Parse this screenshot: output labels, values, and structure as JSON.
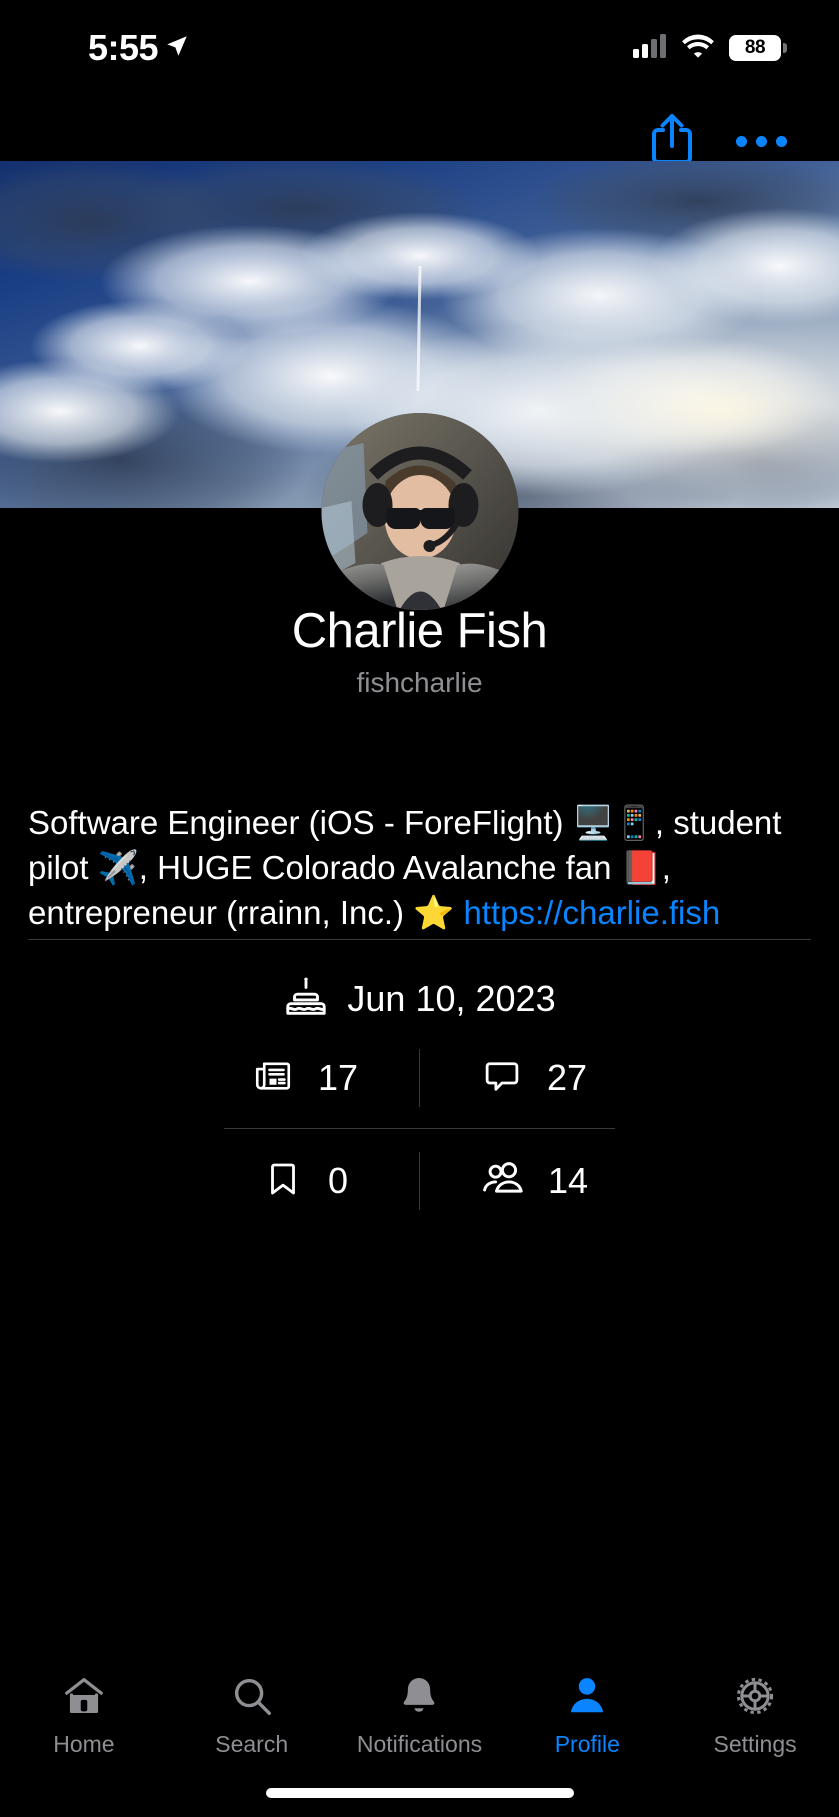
{
  "status_bar": {
    "time": "5:55",
    "location_icon": "location-arrow-icon",
    "cellular_icon": "cellular-bars-icon",
    "wifi_icon": "wifi-icon",
    "battery_percent": "88"
  },
  "nav": {
    "share_icon": "share-icon",
    "more_icon": "more-horizontal-icon",
    "accent_color": "#0A84FF"
  },
  "profile": {
    "banner_image": "sky-clouds-banner",
    "avatar_image": "pilot-headset-portrait-avatar",
    "name": "Charlie Fish",
    "username": "fishcharlie",
    "bio": {
      "segments": [
        {
          "type": "text",
          "value": "Software Engineer (iOS - ForeFlight) "
        },
        {
          "type": "emoji",
          "value": "🖥️"
        },
        {
          "type": "emoji",
          "value": "📱"
        },
        {
          "type": "text",
          "value": ", student pilot "
        },
        {
          "type": "emoji",
          "value": "✈️"
        },
        {
          "type": "text",
          "value": ", HUGE Colorado Avalanche fan "
        },
        {
          "type": "emoji",
          "value": "📕"
        },
        {
          "type": "text",
          "value": ", entrepreneur (rrainn, Inc.) "
        },
        {
          "type": "emoji",
          "value": "⭐"
        },
        {
          "type": "link",
          "value": "https://charlie.fish"
        }
      ],
      "line1": "Software Engineer (iOS - ForeFlight) 🖥️📱, student",
      "line2": "pilot ✈️, HUGE Colorado Avalanche fan 📕,",
      "line3_text": "entrepreneur (rrainn, Inc.) ⭐ ",
      "line3_link": "https://charlie.fish"
    }
  },
  "meta": {
    "join_date": {
      "icon": "birthday-cake-icon",
      "value": "Jun 10, 2023"
    },
    "stats": [
      {
        "icon": "posts-newspaper-icon",
        "label": "posts",
        "value": "17"
      },
      {
        "icon": "comment-bubble-icon",
        "label": "comments",
        "value": "27"
      },
      {
        "icon": "bookmark-icon",
        "label": "bookmarks",
        "value": "0"
      },
      {
        "icon": "people-group-icon",
        "label": "followers",
        "value": "14"
      }
    ]
  },
  "tabbar": {
    "active": "Profile",
    "items": [
      {
        "label": "Home",
        "icon": "home-icon",
        "active": false
      },
      {
        "label": "Search",
        "icon": "search-icon",
        "active": false
      },
      {
        "label": "Notifications",
        "icon": "bell-icon",
        "active": false
      },
      {
        "label": "Profile",
        "icon": "person-icon",
        "active": true
      },
      {
        "label": "Settings",
        "icon": "gear-icon",
        "active": false
      }
    ]
  }
}
